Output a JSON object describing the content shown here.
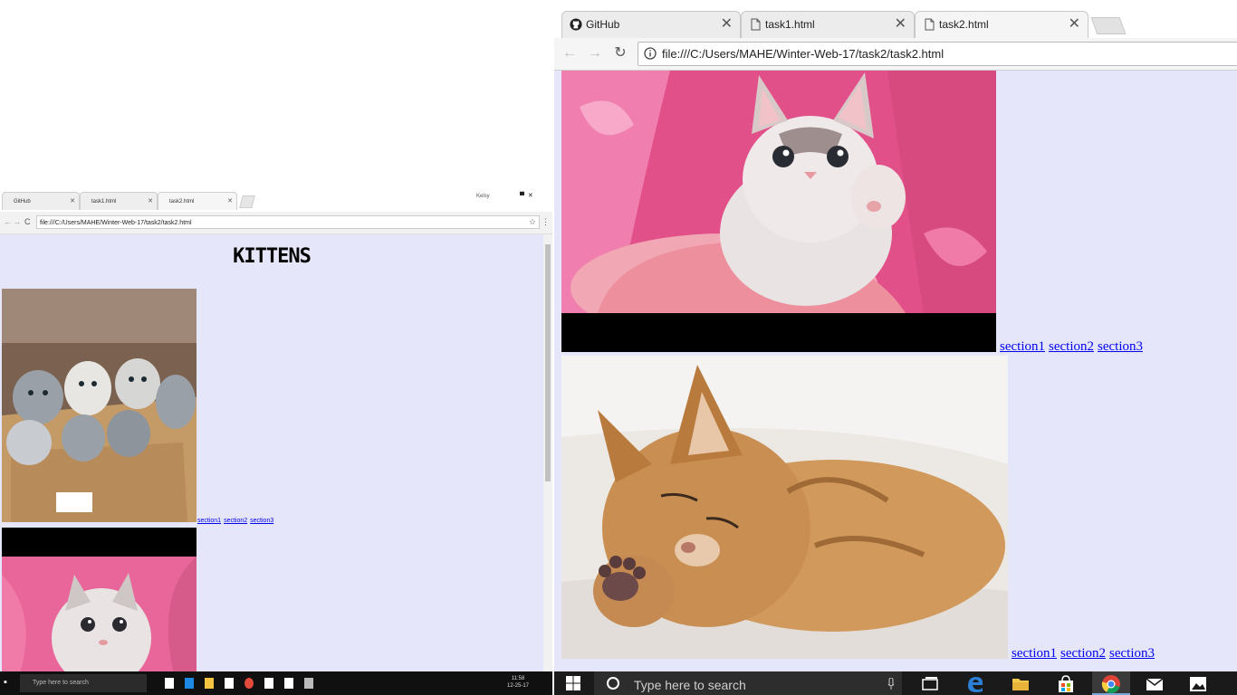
{
  "left_window": {
    "tabs": [
      {
        "label": "GitHub"
      },
      {
        "label": "task1.html"
      },
      {
        "label": "task2.html"
      }
    ],
    "user_label": "Kelsy",
    "url": "file:///C:/Users/MAHE/Winter-Web-17/task2/task2.html",
    "heading": "KITTENS",
    "links": [
      "section1",
      "section2",
      "section3"
    ],
    "taskbar_search_placeholder": "Type here to search",
    "clock_time": "11:58",
    "clock_date": "12-25-17"
  },
  "right_window": {
    "tabs": [
      {
        "label": "GitHub",
        "icon": "github-icon"
      },
      {
        "label": "task1.html",
        "icon": "document-icon"
      },
      {
        "label": "task2.html",
        "icon": "document-icon",
        "active": true
      }
    ],
    "url": "file:///C:/Users/MAHE/Winter-Web-17/task2/task2.html",
    "content": {
      "row1_links": [
        "section1",
        "section2",
        "section3"
      ],
      "row2_links": [
        "section1",
        "section2",
        "section3"
      ]
    }
  },
  "taskbar": {
    "search_placeholder": "Type here to search",
    "icons": [
      "start-icon",
      "task-view-icon",
      "edge-icon",
      "file-explorer-icon",
      "store-icon",
      "chrome-icon",
      "mail-icon",
      "photos-icon"
    ]
  },
  "colors": {
    "page_background": "#e6e6fa",
    "link": "#0000ee",
    "taskbar": "#1a1a1a"
  }
}
